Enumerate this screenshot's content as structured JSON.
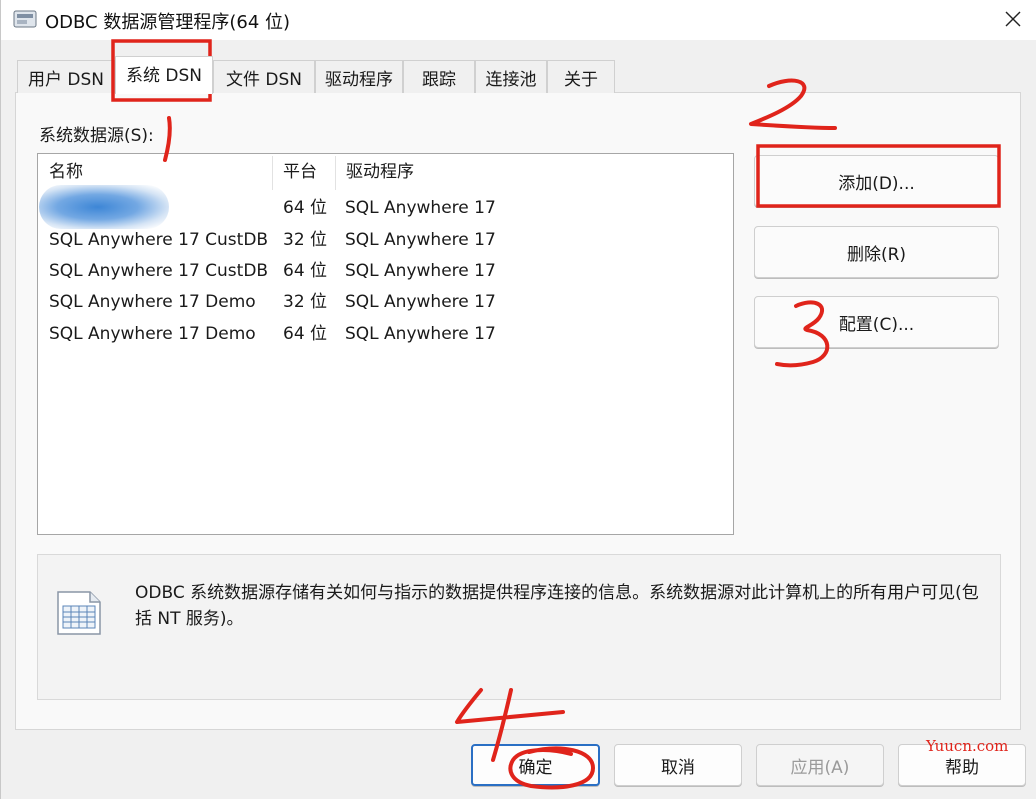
{
  "window": {
    "title": "ODBC 数据源管理程序(64 位)"
  },
  "tabs": [
    {
      "label": "用户 DSN"
    },
    {
      "label": "系统 DSN"
    },
    {
      "label": "文件 DSN"
    },
    {
      "label": "驱动程序"
    },
    {
      "label": "跟踪"
    },
    {
      "label": "连接池"
    },
    {
      "label": "关于"
    }
  ],
  "list": {
    "label": "系统数据源(S):",
    "columns": [
      "名称",
      "平台",
      "驱动程序"
    ],
    "rows": [
      {
        "name": "",
        "platform": "64 位",
        "driver": "SQL Anywhere 17"
      },
      {
        "name": "SQL Anywhere 17 CustDB",
        "platform": "32 位",
        "driver": "SQL Anywhere 17"
      },
      {
        "name": "SQL Anywhere 17 CustDB",
        "platform": "64 位",
        "driver": "SQL Anywhere 17"
      },
      {
        "name": "SQL Anywhere 17 Demo",
        "platform": "32 位",
        "driver": "SQL Anywhere 17"
      },
      {
        "name": "SQL Anywhere 17 Demo",
        "platform": "64 位",
        "driver": "SQL Anywhere 17"
      }
    ]
  },
  "buttons": {
    "add": "添加(D)...",
    "remove": "删除(R)",
    "configure": "配置(C)..."
  },
  "info": {
    "text": "ODBC 系统数据源存储有关如何与指示的数据提供程序连接的信息。系统数据源对此计算机上的所有用户可见(包括 NT 服务)。"
  },
  "footer": {
    "ok": "确定",
    "cancel": "取消",
    "apply": "应用(A)",
    "help": "帮助"
  },
  "annotations": {
    "n1": "1",
    "n2": "2",
    "n3": "3",
    "n4": "4",
    "color": "#e0241b"
  },
  "watermark": "Yuucn.com"
}
